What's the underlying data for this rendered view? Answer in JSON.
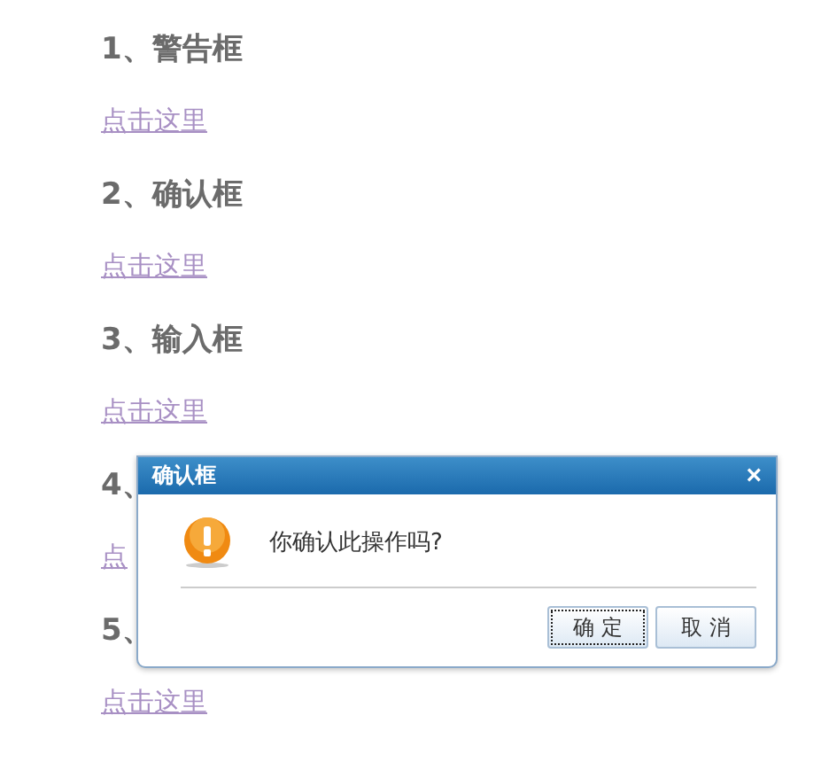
{
  "sections": [
    {
      "heading": "1、警告框",
      "link": "点击这里"
    },
    {
      "heading": "2、确认框",
      "link": "点击这里"
    },
    {
      "heading": "3、输入框",
      "link": "点击这里"
    },
    {
      "heading": "4、",
      "link": "点"
    },
    {
      "heading": "5、",
      "link": "点击这里"
    }
  ],
  "dialog": {
    "title": "确认框",
    "close": "×",
    "message": "你确认此操作吗?",
    "buttons": [
      {
        "label": "确 定",
        "focused": true
      },
      {
        "label": "取 消",
        "focused": false
      }
    ]
  }
}
